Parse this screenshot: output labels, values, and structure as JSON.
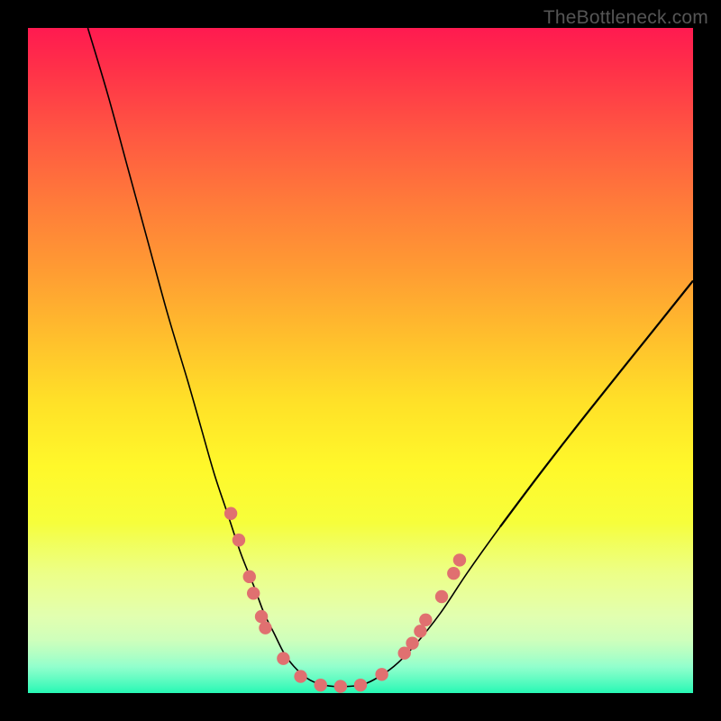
{
  "watermark": "TheBottleneck.com",
  "chart_data": {
    "type": "line",
    "title": "",
    "xlabel": "",
    "ylabel": "",
    "xlim": [
      0,
      100
    ],
    "ylim": [
      0,
      100
    ],
    "grid": false,
    "legend": false,
    "series": [
      {
        "name": "curve",
        "x": [
          9,
          12,
          15,
          18,
          21,
          24,
          26,
          28,
          30,
          32,
          34,
          35.5,
          37,
          38.5,
          40,
          42,
          44,
          46,
          48,
          50,
          52,
          55,
          58,
          62,
          66,
          71,
          77,
          84,
          92,
          100
        ],
        "y": [
          100,
          90,
          79,
          68,
          57,
          47,
          40,
          33,
          27,
          21,
          16,
          12,
          9,
          6,
          4,
          2.2,
          1.3,
          1,
          1,
          1.2,
          2,
          4,
          7,
          12,
          18,
          25,
          33,
          42,
          52,
          62
        ]
      }
    ],
    "markers": {
      "name": "dots",
      "points": [
        {
          "x": 30.5,
          "y": 27
        },
        {
          "x": 31.7,
          "y": 23
        },
        {
          "x": 33.3,
          "y": 17.5
        },
        {
          "x": 33.9,
          "y": 15
        },
        {
          "x": 35.1,
          "y": 11.5
        },
        {
          "x": 35.7,
          "y": 9.8
        },
        {
          "x": 38.4,
          "y": 5.2
        },
        {
          "x": 41.0,
          "y": 2.5
        },
        {
          "x": 44.0,
          "y": 1.2
        },
        {
          "x": 47.0,
          "y": 1.0
        },
        {
          "x": 50.0,
          "y": 1.2
        },
        {
          "x": 53.2,
          "y": 2.8
        },
        {
          "x": 56.6,
          "y": 6.0
        },
        {
          "x": 57.8,
          "y": 7.5
        },
        {
          "x": 59.0,
          "y": 9.3
        },
        {
          "x": 59.8,
          "y": 11.0
        },
        {
          "x": 62.2,
          "y": 14.5
        },
        {
          "x": 64.0,
          "y": 18.0
        },
        {
          "x": 64.9,
          "y": 20.0
        }
      ]
    },
    "background": "rainbow-gradient",
    "annotations": []
  }
}
